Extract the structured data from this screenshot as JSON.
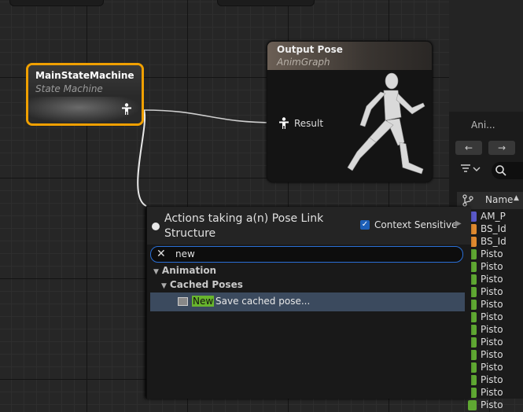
{
  "graph": {
    "state_machine_node": {
      "title": "MainStateMachine",
      "subtitle": "State Machine"
    },
    "output_node": {
      "title": "Output Pose",
      "subtitle": "AnimGraph",
      "pin_label": "Result"
    }
  },
  "action_menu": {
    "title": "Actions taking a(n) Pose Link Structure",
    "context_sensitive_label": "Context Sensitive",
    "context_sensitive_checked": true,
    "search_value": "new",
    "categories": [
      {
        "label": "Animation",
        "subcategories": [
          {
            "label": "Cached Poses"
          }
        ]
      }
    ],
    "items": [
      {
        "highlight": "New",
        "rest": "Save cached pose..."
      }
    ]
  },
  "right_panel": {
    "tab_label": "Ani...",
    "column_header": "Name",
    "assets": [
      {
        "name": "AM_P",
        "icon": "anim-montage-icon",
        "color": "#5a59c8"
      },
      {
        "name": "BS_Id",
        "icon": "blendspace-icon",
        "color": "#e08a2f"
      },
      {
        "name": "BS_Id",
        "icon": "blendspace-icon",
        "color": "#e08a2f"
      },
      {
        "name": "Pisto",
        "icon": "anim-sequence-icon",
        "color": "#5fa832"
      },
      {
        "name": "Pisto",
        "icon": "anim-sequence-icon",
        "color": "#5fa832"
      },
      {
        "name": "Pisto",
        "icon": "anim-sequence-icon",
        "color": "#5fa832"
      },
      {
        "name": "Pisto",
        "icon": "anim-sequence-icon",
        "color": "#5fa832"
      },
      {
        "name": "Pisto",
        "icon": "anim-sequence-icon",
        "color": "#5fa832"
      },
      {
        "name": "Pisto",
        "icon": "anim-sequence-icon",
        "color": "#5fa832"
      },
      {
        "name": "Pisto",
        "icon": "anim-sequence-icon",
        "color": "#5fa832"
      },
      {
        "name": "Pisto",
        "icon": "anim-sequence-icon",
        "color": "#5fa832"
      },
      {
        "name": "Pisto",
        "icon": "anim-sequence-icon",
        "color": "#5fa832"
      },
      {
        "name": "Pisto",
        "icon": "anim-sequence-icon",
        "color": "#5fa832"
      },
      {
        "name": "Pisto",
        "icon": "anim-sequence-icon",
        "color": "#5fa832"
      },
      {
        "name": "Pisto",
        "icon": "anim-sequence-icon",
        "color": "#5fa832"
      },
      {
        "name": "Pisto",
        "icon": "anim-sequence-icon",
        "color": "#5fa832"
      }
    ]
  },
  "colors": {
    "selected_node_border": "#f0a000",
    "accent": "#2a6fd6",
    "search_highlight": "#68b52d"
  }
}
